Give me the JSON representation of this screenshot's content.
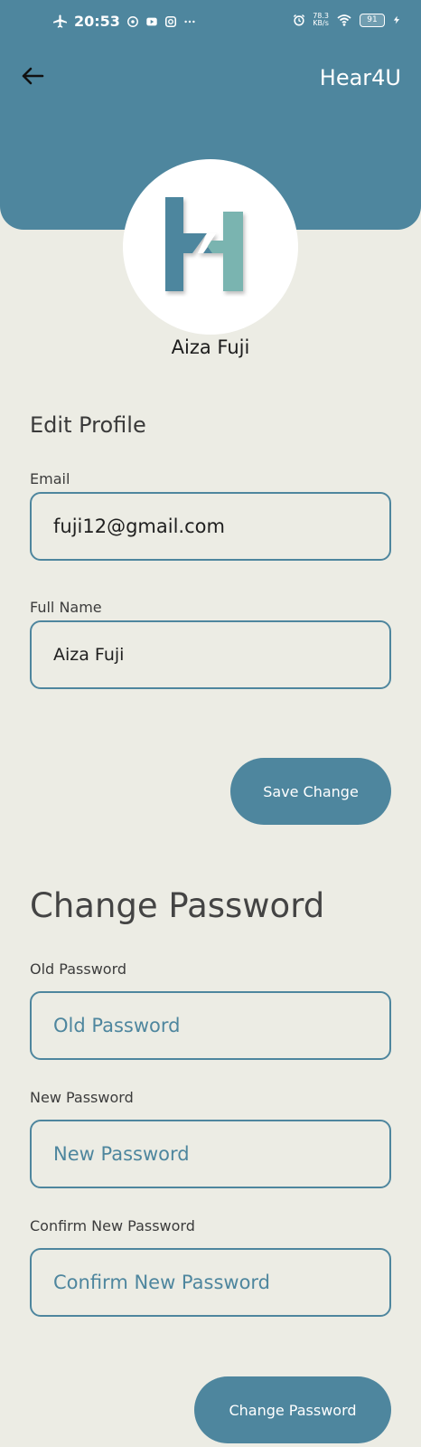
{
  "status_bar": {
    "time": "20:53",
    "net_speed_value": "78.3",
    "net_speed_unit": "KB/s",
    "battery": "91",
    "icons_left": [
      "airplane-icon",
      "whatsapp-icon",
      "youtube-icon",
      "instagram-icon",
      "more-icon"
    ],
    "icons_right": [
      "alarm-icon",
      "wifi-icon",
      "battery-icon",
      "charging-icon"
    ]
  },
  "header": {
    "app_title": "Hear4U",
    "back_icon": "arrow-left-icon"
  },
  "colors": {
    "primary": "#4e869e",
    "logo_dark": "#4e869e",
    "logo_light": "#7ab4b0",
    "background": "#ecece4"
  },
  "profile": {
    "name": "Aiza Fuji",
    "avatar_icon": "hear4u-logo-icon"
  },
  "edit_profile": {
    "title": "Edit Profile",
    "email_label": "Email",
    "email_value": "fuji12@gmail.com",
    "full_name_label": "Full Name",
    "full_name_value": "Aiza Fuji",
    "save_button": "Save Change"
  },
  "change_password": {
    "title": "Change Password",
    "old_label": "Old Password",
    "old_placeholder": "Old Password",
    "new_label": "New Password",
    "new_placeholder": "New Password",
    "confirm_label": "Confirm New Password",
    "confirm_placeholder": "Confirm New Password",
    "submit_button": "Change Password"
  }
}
